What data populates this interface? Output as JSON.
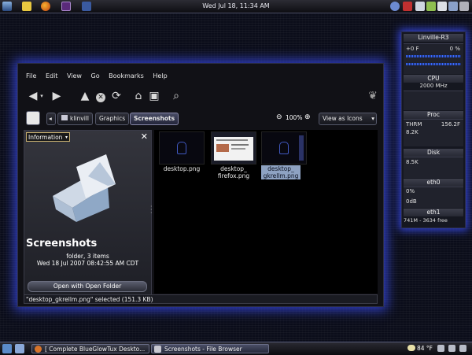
{
  "top_panel": {
    "clock": "Wed Jul 18, 11:34 AM",
    "icons": [
      "menu-icon",
      "folder-icon",
      "firefox-icon",
      "terminal-icon",
      "app-icon"
    ]
  },
  "window": {
    "menu": [
      "File",
      "Edit",
      "View",
      "Go",
      "Bookmarks",
      "Help"
    ],
    "breadcrumbs": [
      "klinvill",
      "Graphics",
      "Screenshots"
    ],
    "zoom": "100%",
    "view_as": "View as Icons",
    "sidepane": {
      "selector": "Information",
      "folder_name": "Screenshots",
      "folder_info": "folder, 3 items",
      "folder_date": "Wed 18 Jul 2007 08:42:55 AM CDT",
      "open_button": "Open with Open Folder"
    },
    "files": [
      "desktop.png",
      "desktop_\nfirefox.png",
      "desktop_\ngkrellm.png"
    ],
    "status": "\"desktop_gkrellm.png\" selected (151.3 KB)"
  },
  "gkrellm": {
    "host": "Linville-R3",
    "cpu_temp_line": "+0  F",
    "cpu_pct": "0 %",
    "cpu_label": "CPU",
    "cpu_freq": "2000 MHz",
    "proc_label": "Proc",
    "thrm_label": "THRM",
    "thrm_value": "156.2F",
    "proc_value": "8.2K",
    "disk_label": "Disk",
    "disk_value": "8.5K",
    "eth0_label": "eth0",
    "eth0_pct": "0%",
    "eth0_db": "0dB",
    "eth1_label": "eth1",
    "mem_line": "741M - 3634 free"
  },
  "taskbar": {
    "tasks": [
      "[ Complete BlueGlowTux Deskto...",
      "Screenshots - File Browser"
    ],
    "weather": "84 °F"
  }
}
